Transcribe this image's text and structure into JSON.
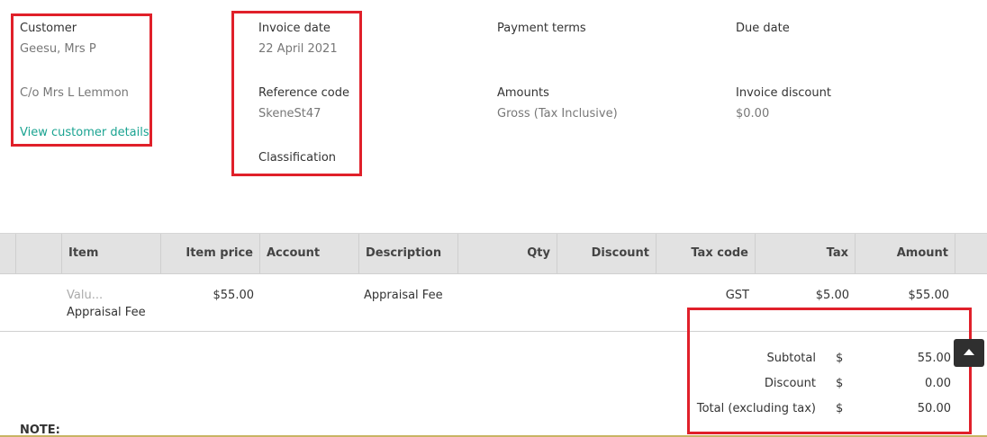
{
  "customer": {
    "label": "Customer",
    "name": "Geesu, Mrs P",
    "address": "C/o Mrs L Lemmon",
    "view_link": "View customer details"
  },
  "invoice": {
    "date_label": "Invoice date",
    "date_value": "22 April 2021",
    "ref_label": "Reference code",
    "ref_value": "SkeneSt47",
    "classification_label": "Classification"
  },
  "payment": {
    "terms_label": "Payment terms",
    "amounts_label": "Amounts",
    "amounts_value": "Gross (Tax Inclusive)"
  },
  "due": {
    "label": "Due date",
    "discount_label": "Invoice discount",
    "discount_value": "$0.00"
  },
  "table": {
    "headers": {
      "item": "Item",
      "item_price": "Item price",
      "account": "Account",
      "description": "Description",
      "qty": "Qty",
      "discount": "Discount",
      "tax_code": "Tax code",
      "tax": "Tax",
      "amount": "Amount"
    },
    "row": {
      "item_code": "Valu...",
      "item_name": "Appraisal Fee",
      "item_price": "$55.00",
      "description": "Appraisal Fee",
      "tax_code": "GST",
      "tax": "$5.00",
      "amount": "$55.00"
    }
  },
  "totals": {
    "subtotal_label": "Subtotal",
    "subtotal_currency": "$",
    "subtotal_value": "55.00",
    "discount_label": "Discount",
    "discount_currency": "$",
    "discount_value": "0.00",
    "total_label": "Total (excluding tax)",
    "total_currency": "$",
    "total_value": "50.00"
  },
  "note_label": "NOTE:",
  "colors": {
    "highlight_box": "#e0202a",
    "link": "#1aa391",
    "table_header_bg": "#e2e2e2"
  },
  "icons": {
    "scroll_top": "chevron-up-icon"
  }
}
